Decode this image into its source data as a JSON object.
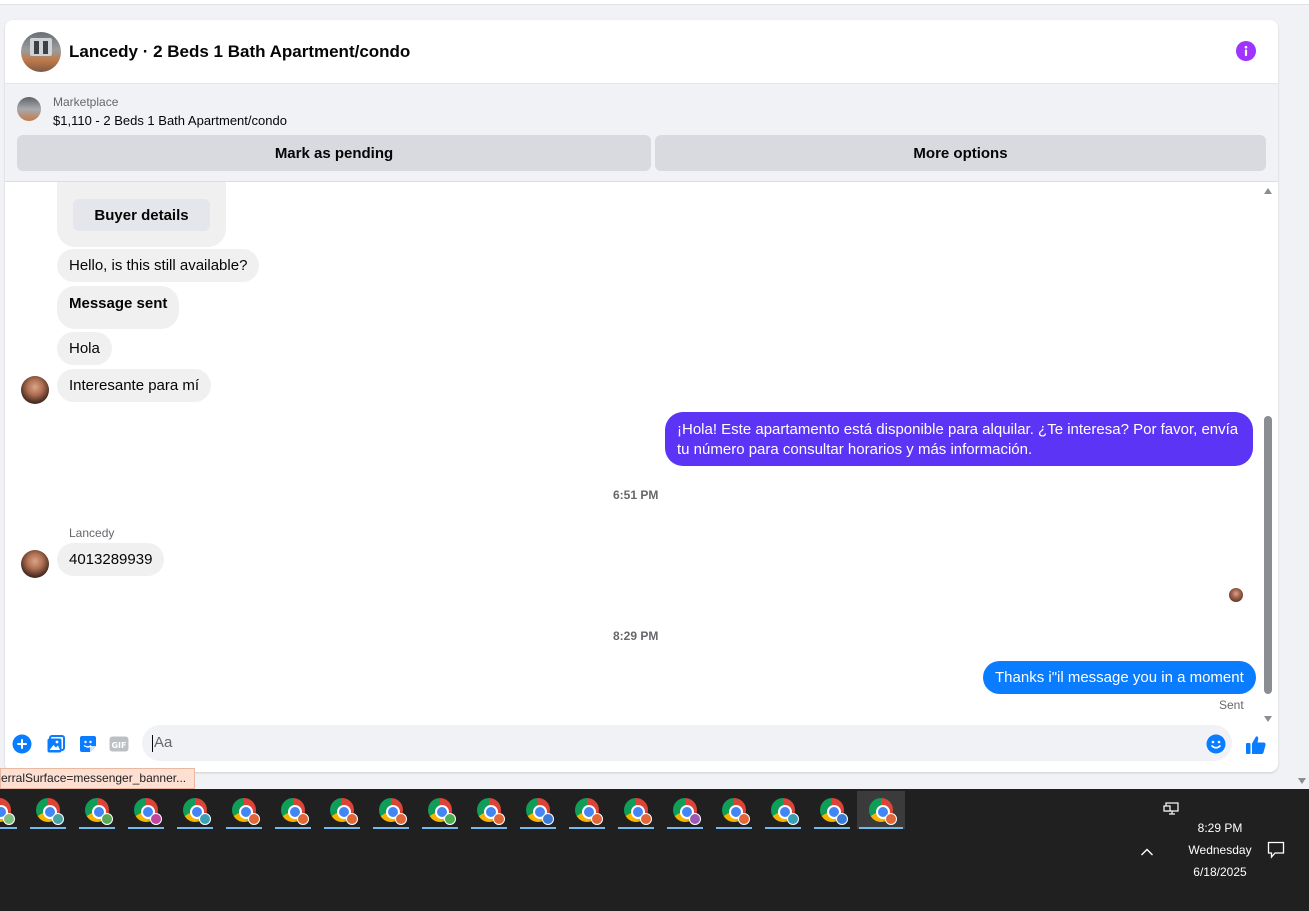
{
  "conversation": {
    "title": "Lancedy · 2 Beds 1 Bath Apartment/condo"
  },
  "marketplace": {
    "label": "Marketplace",
    "listing": "$1,110 - 2 Beds 1 Bath Apartment/condo",
    "pending_button": "Mark as pending",
    "more_button": "More options"
  },
  "messages": {
    "buyer_details_button": "Buyer details",
    "m1": "Hello, is this still available?",
    "m2": "Message sent",
    "m3": "Hola",
    "m4": "Interesante para mí",
    "m5": "¡Hola! Este apartamento está disponible para alquilar. ¿Te interesa? Por favor, envía tu número para consultar horarios y más información.",
    "time1": "6:51 PM",
    "sender": "Lancedy",
    "m6": "4013289939",
    "time2": "8:29 PM",
    "m7": "Thanks i\"il message you in a moment",
    "status": "Sent"
  },
  "composer": {
    "placeholder": "Aa"
  },
  "status_tooltip": "erralSurface=messenger_banner...",
  "taskbar": {
    "time": "8:29 PM",
    "day": "Wednesday",
    "date": "6/18/2025",
    "badge_colors": [
      "#7fbf7f",
      "#4aa3a3",
      "#58a85a",
      "#c1449e",
      "#3aa1b5",
      "#e0673a",
      "#e0673a",
      "#e0673a",
      "#e0673a",
      "#4caf50",
      "#e0673a",
      "#3a7bd5",
      "#e0673a",
      "#e0673a",
      "#9b59b6",
      "#e0673a",
      "#3aa1b5",
      "#3a7bd5",
      "#e0673a"
    ]
  },
  "colors": {
    "outgoing_bubble": "#0a7cff",
    "outgoing_bubble_purple": "#5b34f5",
    "info_icon": "#a033ff"
  }
}
